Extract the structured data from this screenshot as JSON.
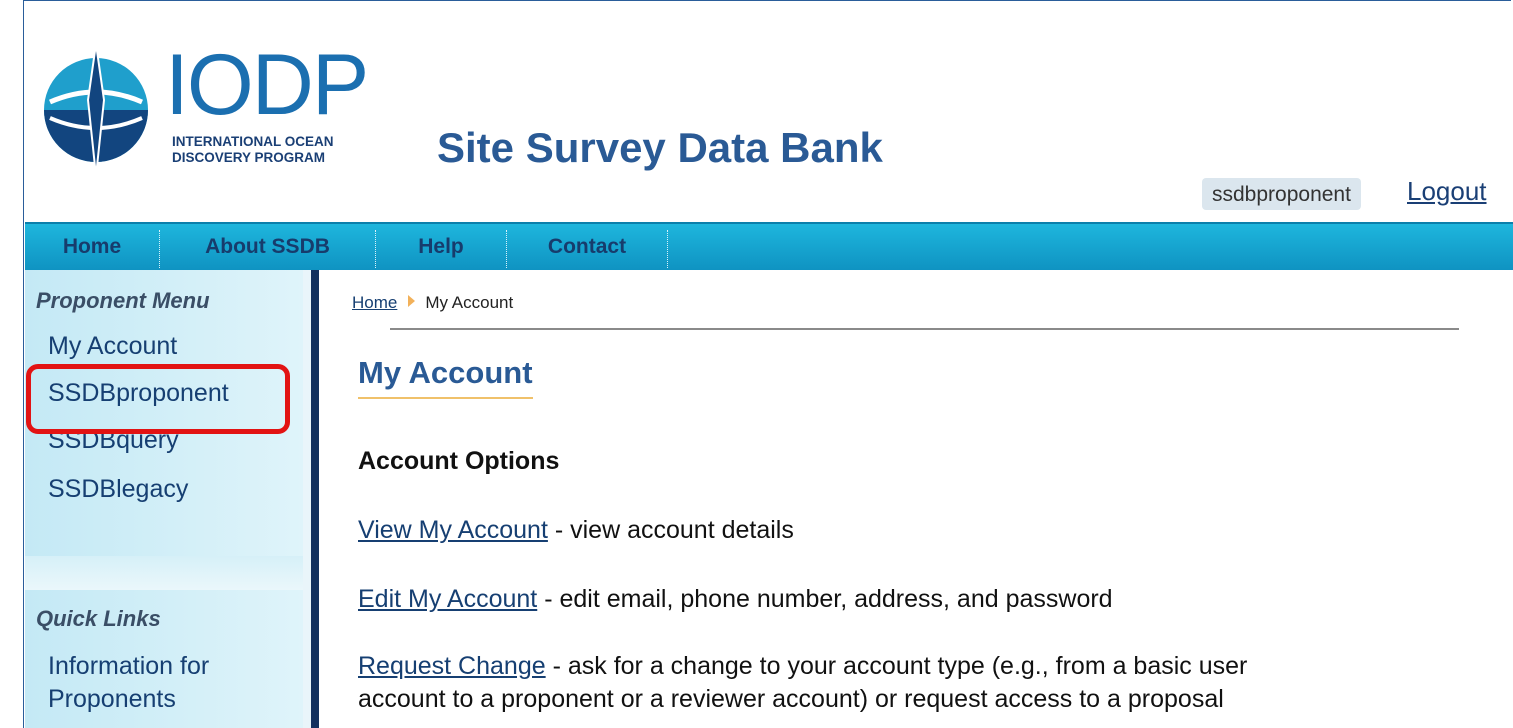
{
  "header": {
    "logo_word": "IODP",
    "logo_subtitle_line1": "INTERNATIONAL OCEAN",
    "logo_subtitle_line2": "DISCOVERY PROGRAM",
    "site_title": "Site Survey Data Bank",
    "username": "ssdbproponent",
    "logout_label": "Logout"
  },
  "nav": {
    "items": [
      {
        "label": "Home"
      },
      {
        "label": "About SSDB"
      },
      {
        "label": "Help"
      },
      {
        "label": "Contact"
      }
    ]
  },
  "sidebar": {
    "proponent_heading": "Proponent Menu",
    "proponent_items": [
      {
        "label": "My Account"
      },
      {
        "label": "SSDBproponent"
      },
      {
        "label": "SSDBquery"
      },
      {
        "label": "SSDBlegacy"
      }
    ],
    "quick_heading": "Quick Links",
    "quick_items": [
      {
        "label_line1": "Information for",
        "label_line2": "Proponents"
      }
    ]
  },
  "breadcrumb": {
    "home": "Home",
    "current": "My Account"
  },
  "main": {
    "title": "My Account",
    "section_title": "Account Options",
    "options": [
      {
        "link": "View My Account",
        "desc": " - view account details"
      },
      {
        "link": "Edit My Account",
        "desc": " - edit email, phone number, address, and password"
      },
      {
        "link": "Request Change",
        "desc": " - ask for a change to your account type (e.g., from a basic user",
        "desc2": "account to a proponent or a reviewer account) or request access to a proposal"
      }
    ]
  },
  "colors": {
    "nav_blue": "#1eb6dd",
    "title_blue": "#2a5a95",
    "highlight_red": "#e21313"
  }
}
